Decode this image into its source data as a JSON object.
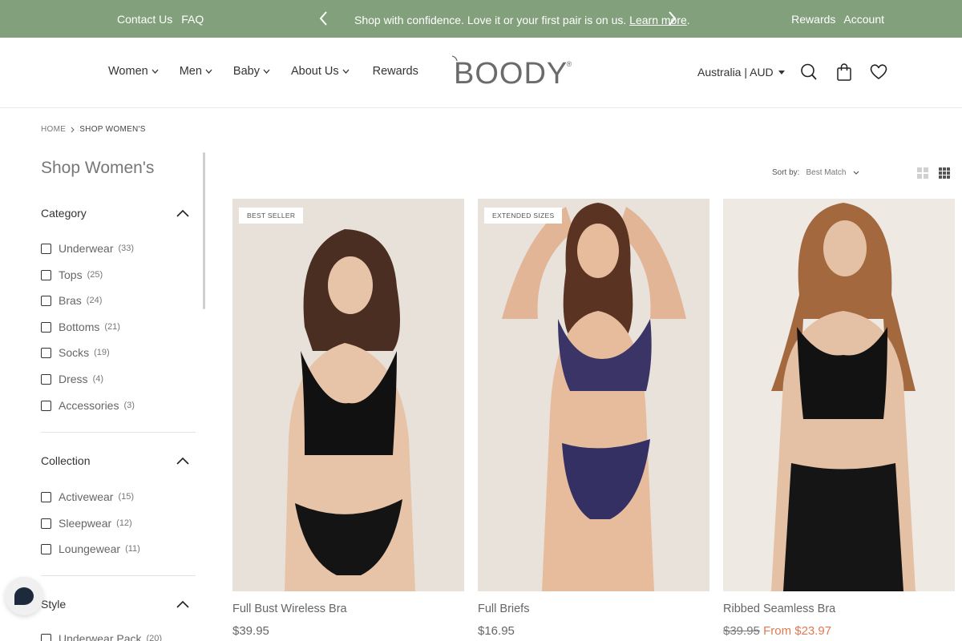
{
  "topbar": {
    "contact": "Contact Us",
    "faq": "FAQ",
    "message": "Shop with confidence. Love it or your first pair is on us.",
    "learn_more": "Learn more",
    "message_end": ".",
    "rewards": "Rewards",
    "account": "Account",
    "bg_color": "#83a07c"
  },
  "header": {
    "nav": [
      "Women",
      "Men",
      "Baby",
      "About Us",
      "Rewards"
    ],
    "logo": "BOODY",
    "locale": "Australia | AUD"
  },
  "breadcrumb": {
    "home": "HOME",
    "current": "SHOP WOMEN'S"
  },
  "sidebar": {
    "title": "Shop Women's",
    "category": {
      "label": "Category",
      "options": [
        {
          "label": "Underwear",
          "count": "(33)"
        },
        {
          "label": "Tops",
          "count": "(25)"
        },
        {
          "label": "Bras",
          "count": "(24)"
        },
        {
          "label": "Bottoms",
          "count": "(21)"
        },
        {
          "label": "Socks",
          "count": "(19)"
        },
        {
          "label": "Dress",
          "count": "(4)"
        },
        {
          "label": "Accessories",
          "count": "(3)"
        }
      ]
    },
    "collection": {
      "label": "Collection",
      "options": [
        {
          "label": "Activewear",
          "count": "(15)"
        },
        {
          "label": "Sleepwear",
          "count": "(12)"
        },
        {
          "label": "Loungewear",
          "count": "(11)"
        }
      ]
    },
    "style": {
      "label": "Style",
      "options": [
        {
          "label": "Underwear Pack",
          "count": "(20)"
        }
      ]
    }
  },
  "sort": {
    "label": "Sort by:",
    "value": "Best Match"
  },
  "products": [
    {
      "name": "Full Bust Wireless Bra",
      "price": "$39.95",
      "badge": "BEST SELLER"
    },
    {
      "name": "Full Briefs",
      "price": "$16.95",
      "badge": "EXTENDED SIZES"
    },
    {
      "name": "Ribbed Seamless Bra",
      "was": "$39.95",
      "sale": "From $23.97"
    }
  ],
  "colors": {
    "accent": "#83a07c",
    "sale": "#e07a53"
  }
}
